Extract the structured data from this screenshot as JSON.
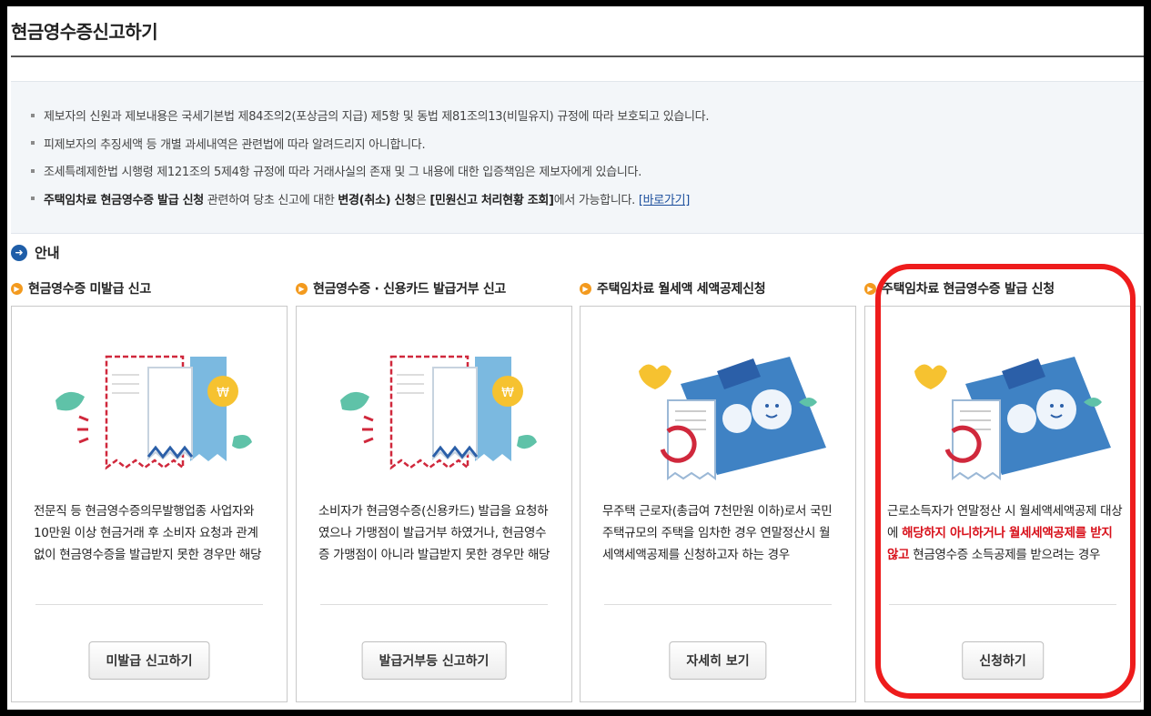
{
  "page": {
    "title": "현금영수증신고하기"
  },
  "notice": {
    "line1": "제보자의 신원과 제보내용은 국세기본법 제84조의2(포상금의 지급) 제5항 및 동법 제81조의13(비밀유지) 규정에 따라 보호되고 있습니다.",
    "line2": "피제보자의 추징세액 등 개별 과세내역은 관련법에 따라 알려드리지 아니합니다.",
    "line3": "조세특례제한법 시행령 제121조의 5제4항 규정에 따라 거래사실의 존재 및 그 내용에 대한 입증책임은 제보자에게 있습니다.",
    "line4": {
      "bold1": "주택임차료 현금영수증 발급 신청",
      "text1": " 관련하여 당초 신고에 대한 ",
      "bold2": "변경(취소) 신청",
      "text2": "은 ",
      "bold3": "[민원신고 처리현황 조회]",
      "text3": "에서 가능합니다. ",
      "link": "[바로가기]"
    }
  },
  "section": {
    "title": "안내"
  },
  "cards": [
    {
      "title": "현금영수증 미발급 신고",
      "desc": "전문직 등 현금영수증의무발행업종 사업자와 10만원 이상 현금거래 후 소비자 요청과 관계 없이 현금영수증을 발급받지 못한 경우만 해당",
      "button": "미발급 신고하기",
      "illustration": "receipt-coin-illustration"
    },
    {
      "title": "현금영수증 · 신용카드 발급거부 신고",
      "desc": "소비자가 현금영수증(신용카드) 발급을 요청하였으나 가맹점이 발급거부 하였거나, 현금영수증 가맹점이 아니라 발급받지 못한 경우만 해당",
      "button": "발급거부등 신고하기",
      "illustration": "receipt-coin-illustration"
    },
    {
      "title": "주택임차료 월세액 세액공제신청",
      "desc": "무주택 근로자(총급여 7천만원 이하)로서 국민주택규모의 주택을 임차한 경우 연말정산시 월세액세액공제를 신청하고자 하는 경우",
      "button": "자세히 보기",
      "illustration": "house-receipt-illustration"
    },
    {
      "title": "주택임차료 현금영수증 발급 신청",
      "desc_part1": "근로소득자가 연말정산 시 월세액세액공제 대상에 ",
      "desc_red": "해당하지 아니하거나 월세세액공제를 받지 않고",
      "desc_part2": " 현금영수증 소득공제를 받으려는 경우",
      "button": "신청하기",
      "illustration": "house-receipt-illustration"
    }
  ],
  "colors": {
    "highlight": "#ee1c1c",
    "accent_blue": "#1f5ea8",
    "bullet_orange": "#f39a1e",
    "emphasis_red": "#d8111b"
  }
}
